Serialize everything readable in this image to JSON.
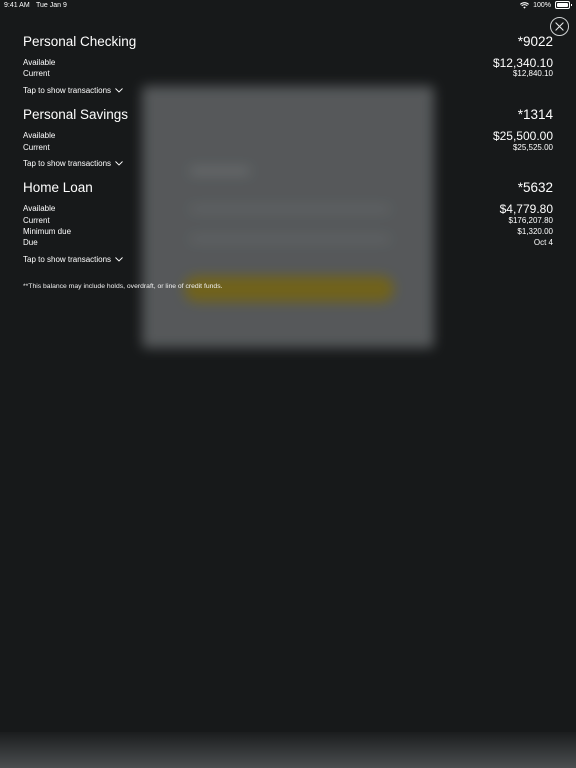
{
  "status_bar": {
    "time": "9:41 AM",
    "date": "Tue Jan 9",
    "battery": "100%",
    "wifi_icon": "wifi-icon",
    "battery_icon": "battery-icon"
  },
  "close_icon": "close-icon",
  "accounts": [
    {
      "name": "Personal Checking",
      "number": "*9022",
      "rows": [
        {
          "label": "Available",
          "value": "$12,340.10"
        },
        {
          "label": "Current",
          "value": "$12,840.10"
        }
      ],
      "tap_label": "Tap to show transactions"
    },
    {
      "name": "Personal Savings",
      "number": "*1314",
      "rows": [
        {
          "label": "Available",
          "value": "$25,500.00"
        },
        {
          "label": "Current",
          "value": "$25,525.00"
        }
      ],
      "tap_label": "Tap to show transactions"
    },
    {
      "name": "Home Loan",
      "number": "*5632",
      "rows": [
        {
          "label": "Available",
          "value": "$4,779.80"
        },
        {
          "label": "Current",
          "value": "$176,207.80"
        },
        {
          "label": "Minimum due",
          "value": "$1,320.00"
        },
        {
          "label": "Due",
          "value": "Oct 4"
        }
      ],
      "tap_label": "Tap to show transactions"
    }
  ],
  "footnote": "**This balance may include holds, overdraft, or line of credit funds."
}
